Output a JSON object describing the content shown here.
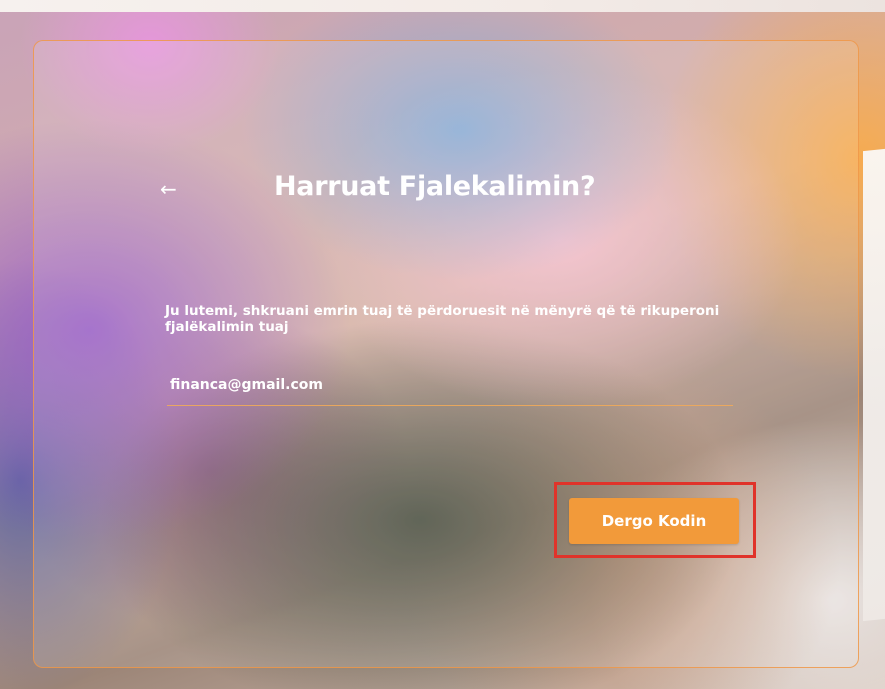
{
  "forgot_password": {
    "title": "Harruat Fjalekalimin?",
    "back_icon": "arrow-left-icon",
    "back_glyph": "←",
    "instructions": "Ju lutemi, shkruani emrin tuaj të përdoruesit në mënyrë që të rikuperoni fjalëkalimin tuaj",
    "email_value": "financa@gmail.com",
    "submit_label": "Dergo Kodin"
  },
  "colors": {
    "accent": "#f29a3a",
    "border": "#ee9646",
    "highlight": "#e0332a",
    "text": "#ffffff"
  }
}
